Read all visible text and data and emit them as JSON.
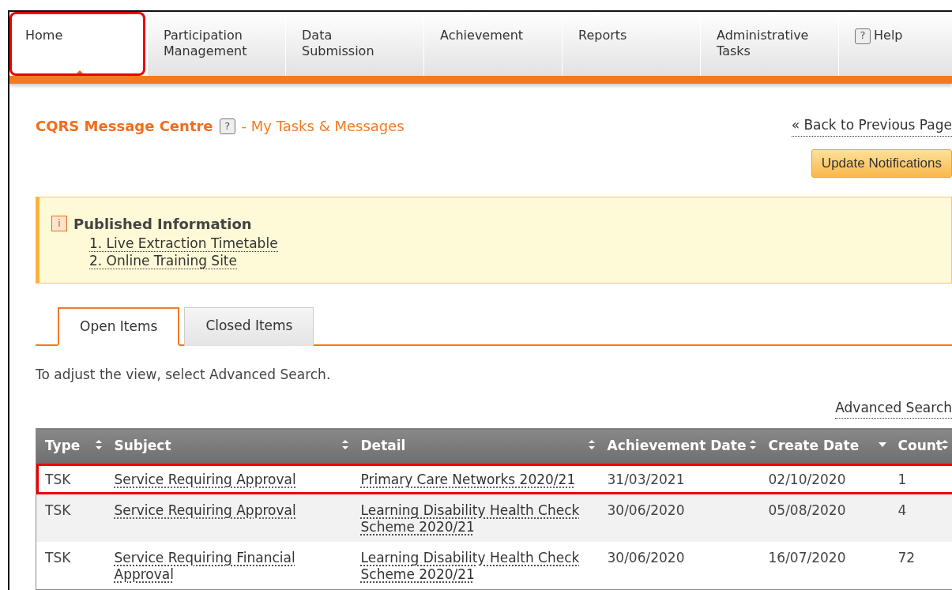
{
  "nav": [
    {
      "label": "Home",
      "selected": true,
      "highlighted": true
    },
    {
      "label": "Participation Management",
      "selected": false,
      "highlighted": false
    },
    {
      "label": "Data Submission",
      "selected": false,
      "highlighted": false
    },
    {
      "label": "Achievement",
      "selected": false,
      "highlighted": false
    },
    {
      "label": "Reports",
      "selected": false,
      "highlighted": false
    },
    {
      "label": "Administrative Tasks",
      "selected": false,
      "highlighted": false
    },
    {
      "label": "Help",
      "selected": false,
      "highlighted": false,
      "icon": "?"
    }
  ],
  "heading": {
    "title": "CQRS Message Centre",
    "help_icon": "?",
    "subtitle": "- My Tasks & Messages"
  },
  "back_link": "« Back to Previous Page",
  "update_button": "Update Notifications",
  "info_panel": {
    "icon": "i",
    "title": "Published Information",
    "links": [
      "1. Live Extraction Timetable",
      "2. Online Training Site"
    ]
  },
  "tabs": [
    {
      "label": "Open Items",
      "selected": true
    },
    {
      "label": "Closed Items",
      "selected": false
    }
  ],
  "hint": "To adjust the view, select Advanced Search.",
  "advanced_search": "Advanced Search",
  "table": {
    "columns": [
      {
        "label": "Type",
        "sort_descending": false
      },
      {
        "label": "Subject",
        "sort_descending": false
      },
      {
        "label": "Detail",
        "sort_descending": false
      },
      {
        "label": "Achievement Date",
        "sort_descending": false
      },
      {
        "label": "Create Date",
        "sort_descending": true
      },
      {
        "label": "Count",
        "sort_descending": false
      }
    ],
    "rows": [
      {
        "highlighted": true,
        "cells": [
          "TSK",
          "Service Requiring Approval",
          "Primary Care Networks 2020/21",
          "31/03/2021",
          "02/10/2020",
          "1"
        ]
      },
      {
        "highlighted": false,
        "cells": [
          "TSK",
          "Service Requiring Approval",
          "Learning Disability Health Check Scheme 2020/21",
          "30/06/2020",
          "05/08/2020",
          "4"
        ]
      },
      {
        "highlighted": false,
        "cells": [
          "TSK",
          "Service Requiring Financial Approval",
          "Learning Disability Health Check Scheme 2020/21",
          "30/06/2020",
          "16/07/2020",
          "72"
        ]
      }
    ]
  }
}
